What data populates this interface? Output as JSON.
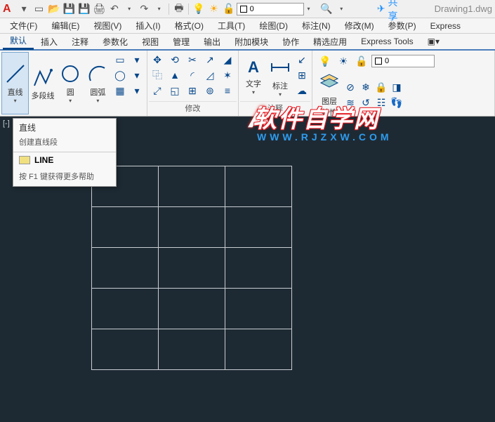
{
  "titlebar": {
    "layer_value": "0",
    "share_label": "共享",
    "document_name": "Drawing1.dwg"
  },
  "menus": [
    "文件(F)",
    "编辑(E)",
    "视图(V)",
    "插入(I)",
    "格式(O)",
    "工具(T)",
    "绘图(D)",
    "标注(N)",
    "修改(M)",
    "参数(P)",
    "Express"
  ],
  "ribbon_tabs": [
    "默认",
    "插入",
    "注释",
    "参数化",
    "视图",
    "管理",
    "输出",
    "附加模块",
    "协作",
    "精选应用",
    "Express Tools"
  ],
  "active_tab_index": 0,
  "draw_panel": {
    "line": "直线",
    "polyline": "多段线",
    "circle": "圆",
    "arc": "圆弧"
  },
  "panel_labels": {
    "modify": "修改",
    "annotation": "注释",
    "layers": "图层"
  },
  "annotation": {
    "text": "文字",
    "dim": "标注"
  },
  "layers": {
    "props": "图层\n特性",
    "current": "0"
  },
  "tooltip": {
    "title": "直线",
    "desc": "创建直线段",
    "command": "LINE",
    "help": "按 F1 键获得更多帮助"
  },
  "viewport_tag": "[-]",
  "watermark": {
    "line1": "软件自学网",
    "line2": "WWW.RJZXW.COM"
  }
}
